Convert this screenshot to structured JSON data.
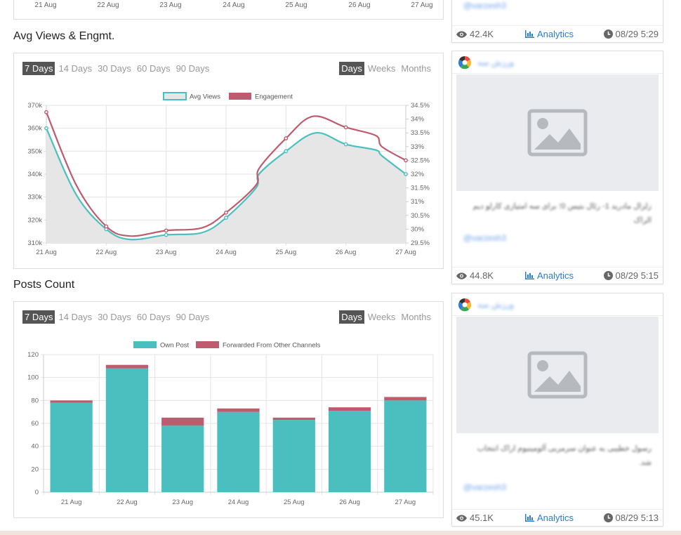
{
  "top_panel": {
    "ticks": [
      "21 Aug",
      "22 Aug",
      "23 Aug",
      "24 Aug",
      "25 Aug",
      "26 Aug",
      "27 Aug"
    ]
  },
  "sections": {
    "views_title": "Avg Views & Engmt.",
    "posts_title": "Posts Count"
  },
  "range_options": [
    "7 Days",
    "14 Days",
    "30 Days",
    "60 Days",
    "90 Days"
  ],
  "unit_options": [
    "Days",
    "Weeks",
    "Months"
  ],
  "views_panel": {
    "active_range": "7 Days",
    "active_unit": "Days"
  },
  "posts_panel": {
    "active_range": "7 Days",
    "active_unit": "Days"
  },
  "chart_data": [
    {
      "type": "line",
      "categories": [
        "21 Aug",
        "22 Aug",
        "23 Aug",
        "24 Aug",
        "25 Aug",
        "26 Aug",
        "27 Aug"
      ],
      "series": [
        {
          "name": "Avg Views",
          "axis": "left",
          "color": "#4bbfbf",
          "fill": "#e6e6e6",
          "points": [
            [
              0,
              360000
            ],
            [
              0.5,
              331000
            ],
            [
              1,
              316000
            ],
            [
              1.4,
              311500
            ],
            [
              2,
              313500
            ],
            [
              2.6,
              314500
            ],
            [
              3,
              321000
            ],
            [
              3.5,
              334000
            ],
            [
              3.55,
              340000
            ],
            [
              4,
              350000
            ],
            [
              4.5,
              358000
            ],
            [
              5,
              353000
            ],
            [
              5.5,
              350500
            ],
            [
              5.6,
              348000
            ],
            [
              6,
              340000
            ]
          ]
        },
        {
          "name": "Engagement",
          "axis": "right",
          "color": "#bf5b6e",
          "points": [
            [
              0,
              34.25
            ],
            [
              0.5,
              31.6
            ],
            [
              1,
              30.1
            ],
            [
              1.4,
              29.75
            ],
            [
              2,
              29.95
            ],
            [
              2.6,
              30.05
            ],
            [
              3,
              30.6
            ],
            [
              3.5,
              31.6
            ],
            [
              3.55,
              32.2
            ],
            [
              4,
              33.3
            ],
            [
              4.45,
              34.1
            ],
            [
              5,
              33.7
            ],
            [
              5.5,
              33.4
            ],
            [
              5.6,
              33.0
            ],
            [
              6,
              32.5
            ]
          ]
        }
      ],
      "y_left": {
        "min": 310000,
        "max": 370000,
        "ticks": [
          "310k",
          "320k",
          "330k",
          "340k",
          "350k",
          "360k",
          "370k"
        ]
      },
      "y_right": {
        "min": 29.5,
        "max": 34.5,
        "ticks": [
          "29.5%",
          "30%",
          "30.5%",
          "31%",
          "31.5%",
          "32%",
          "32.5%",
          "33%",
          "33.5%",
          "34%",
          "34.5%"
        ]
      },
      "legend": "top",
      "grid": true
    },
    {
      "type": "bar",
      "stacked": true,
      "categories": [
        "21 Aug",
        "22 Aug",
        "23 Aug",
        "24 Aug",
        "25 Aug",
        "26 Aug",
        "27 Aug"
      ],
      "series": [
        {
          "name": "Own Post",
          "color": "#4bbfbf",
          "values": [
            78,
            108,
            58,
            70,
            63,
            71,
            80
          ]
        },
        {
          "name": "Forwarded From Other Channels",
          "color": "#bf5b6e",
          "values": [
            2,
            3,
            7,
            3,
            2,
            3,
            3
          ]
        }
      ],
      "ylim": [
        0,
        120
      ],
      "y_ticks": [
        "0",
        "20",
        "40",
        "60",
        "80",
        "100",
        "120"
      ],
      "legend": "top",
      "grid": true
    }
  ],
  "cards": [
    {
      "author": "@varzesh3",
      "views": "42.4K",
      "analytics": "Analytics",
      "time": "08/29 5:29"
    },
    {
      "name": "ورزش سه",
      "text": "زلزال مادرید 1- رئال بتیس 0؛ برای سه امتیازی کارلو دیم الراک",
      "author": "@varzesh3",
      "views": "44.8K",
      "analytics": "Analytics",
      "time": "08/29 5:15"
    },
    {
      "name": "ورزش سه",
      "text": "رسول خطیبی به عنوان سرمربی آلومینیوم اراک انتخاب شد.",
      "author": "@varzesh3",
      "views": "45.1K",
      "analytics": "Analytics",
      "time": "08/29 5:13"
    }
  ]
}
